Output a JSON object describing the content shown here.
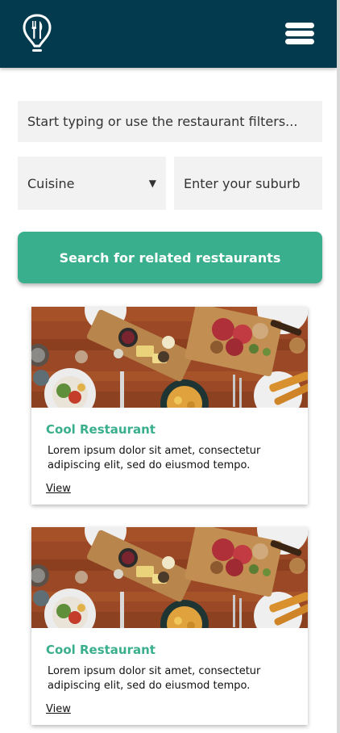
{
  "header": {
    "logo_icon": "map-pin-cutlery-icon",
    "menu_icon": "hamburger-menu-icon",
    "background_color": "#033a4d"
  },
  "search": {
    "placeholder": "Start typing or use the restaurant filters...",
    "value": ""
  },
  "filters": {
    "cuisine_label": "Cuisine",
    "cuisine_arrow": "▼",
    "suburb_placeholder": "Enter your suburb"
  },
  "search_button": {
    "label": "Search for related restaurants",
    "color": "#3aaf8d"
  },
  "restaurants": [
    {
      "name": "Cool Restaurant",
      "description": "Lorem ipsum dolor sit amet, consectetur adipiscing elit, sed do eiusmod tempo.",
      "link_label": "View",
      "image": "food-platter-photo"
    },
    {
      "name": "Cool Restaurant",
      "description": "Lorem ipsum dolor sit amet, consectetur adipiscing elit, sed do eiusmod tempo.",
      "link_label": "View",
      "image": "food-platter-photo"
    }
  ]
}
